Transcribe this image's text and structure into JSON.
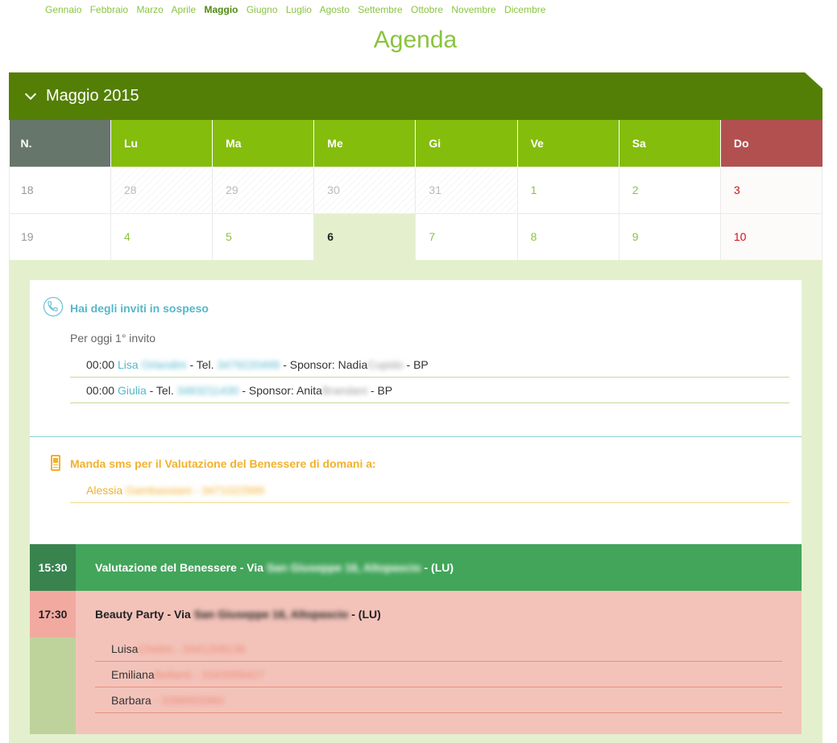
{
  "months": [
    "Gennaio",
    "Febbraio",
    "Marzo",
    "Aprile",
    "Maggio",
    "Giugno",
    "Luglio",
    "Agosto",
    "Settembre",
    "Ottobre",
    "Novembre",
    "Dicembre"
  ],
  "active_month": "Maggio",
  "title": "Agenda",
  "month_header": "Maggio 2015",
  "calendar": {
    "headers": [
      "N.",
      "Lu",
      "Ma",
      "Me",
      "Gi",
      "Ve",
      "Sa",
      "Do"
    ],
    "weeks": [
      {
        "week": "18",
        "days": [
          "28",
          "29",
          "30",
          "31",
          "1",
          "2",
          "3"
        ]
      },
      {
        "week": "19",
        "days": [
          "4",
          "5",
          "6",
          "7",
          "8",
          "9",
          "10"
        ]
      }
    ]
  },
  "invites": {
    "title": "Hai degli inviti in sospeso",
    "subtitle": "Per oggi 1° invito",
    "rows": [
      {
        "time": "00:00",
        "name": "Lisa",
        "surname": "Orlandini",
        "tel_label": "- Tel.",
        "tel": "3479220499",
        "sponsor_label": "- Sponsor: Nadia",
        "sponsor_surname": "Cupido",
        "suffix": "- BP"
      },
      {
        "time": "00:00",
        "name": "Giulia",
        "surname": "",
        "tel_label": "- Tel.",
        "tel": "3483211430",
        "sponsor_label": "- Sponsor: Anita",
        "sponsor_surname": "Brandani",
        "suffix": "- BP"
      }
    ]
  },
  "sms": {
    "title": "Manda sms per il Valutazione del Benessere di domani a:",
    "name": "Alessia",
    "surname": "Gambassiani - 3471022999"
  },
  "appointments": [
    {
      "time": "15:30",
      "title": "Valutazione del Benessere - Via",
      "address": "San Giuseppe 16, Altopascio",
      "suffix": "- (LU)"
    },
    {
      "time": "17:30",
      "title": "Beauty Party - Via",
      "address": "San Giuseppe 16, Altopascio",
      "suffix": "- (LU)",
      "guests": [
        {
          "name": "Luisa",
          "detail": "Chelini - 3441208136"
        },
        {
          "name": "Emiliana",
          "detail": "Bellanti - 3343999427"
        },
        {
          "name": "Barbara",
          "detail": "- 3386955960"
        }
      ]
    }
  ],
  "colors": {
    "accent_green": "#8ac43f",
    "header_green": "#547f06",
    "sunday_red": "#b25050",
    "invite_blue": "#55b7cb",
    "sms_orange": "#f2b12d"
  }
}
